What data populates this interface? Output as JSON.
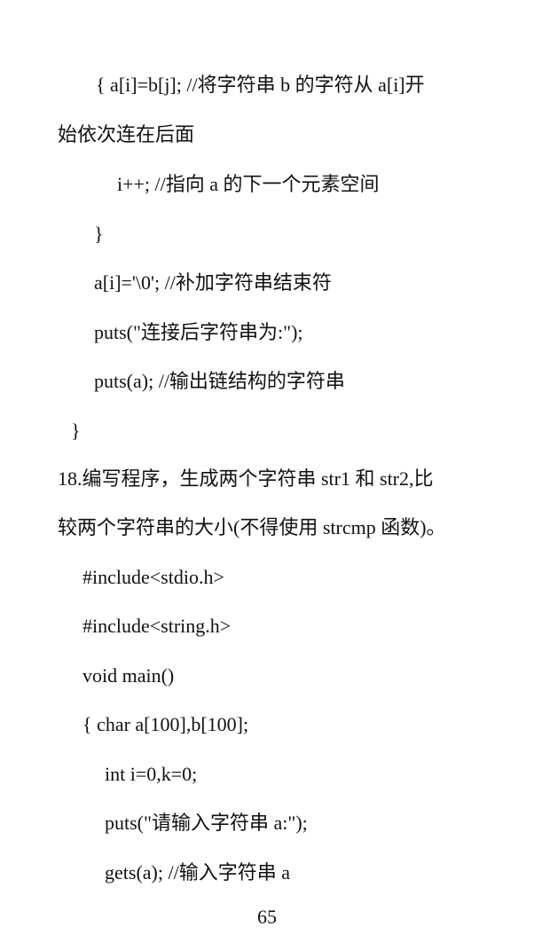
{
  "document": {
    "lines": [
      "{ a[i]=b[j]; //将字符串 b 的字符从 a[i]开",
      "始依次连在后面",
      "i++; //指向 a 的下一个元素空间",
      "}",
      "a[i]='\\0'; //补加字符串结束符",
      "puts(\"连接后字符串为:\");",
      "puts(a); //输出链结构的字符串",
      "}",
      "18.编写程序，生成两个字符串 str1 和 str2,比",
      "较两个字符串的大小(不得使用 strcmp 函数)。",
      "#include<stdio.h>",
      "#include<string.h>",
      "void main()",
      "{ char a[100],b[100];",
      "int i=0,k=0;",
      "puts(\"请输入字符串 a:\");",
      "gets(a); //输入字符串 a"
    ],
    "page_number": "65"
  }
}
